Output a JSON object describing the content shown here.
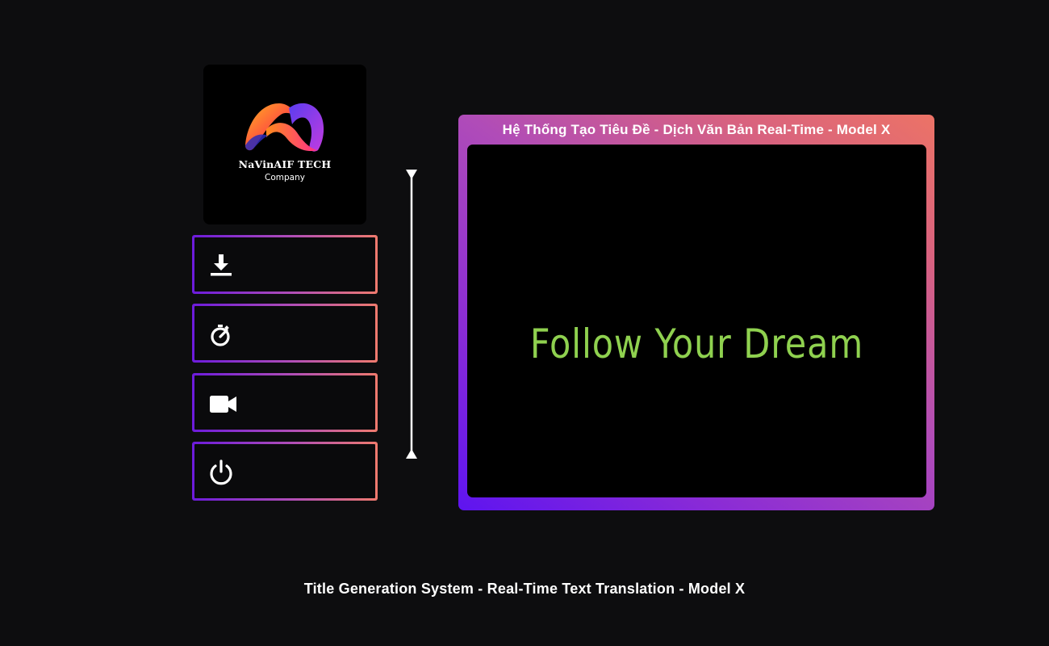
{
  "logo": {
    "company_name": "NaVinAIF TECH",
    "company_sub": "Company",
    "icon": "navinaif-logo-icon"
  },
  "actions": [
    {
      "icon": "download-icon"
    },
    {
      "icon": "timer-icon"
    },
    {
      "icon": "video-camera-icon"
    },
    {
      "icon": "power-icon"
    }
  ],
  "preview": {
    "title": "Hệ Thống Tạo Tiêu Đề - Dịch Văn Bản Real-Time - Model X",
    "display_text": "Follow Your Dream",
    "text_color": "#8fd14f"
  },
  "footer": {
    "caption": "Title Generation System - Real-Time Text Translation - Model X"
  },
  "colors": {
    "background": "#0d0d0f",
    "gradient_start": "#6c1bdc",
    "gradient_end": "#ef7a6e"
  }
}
